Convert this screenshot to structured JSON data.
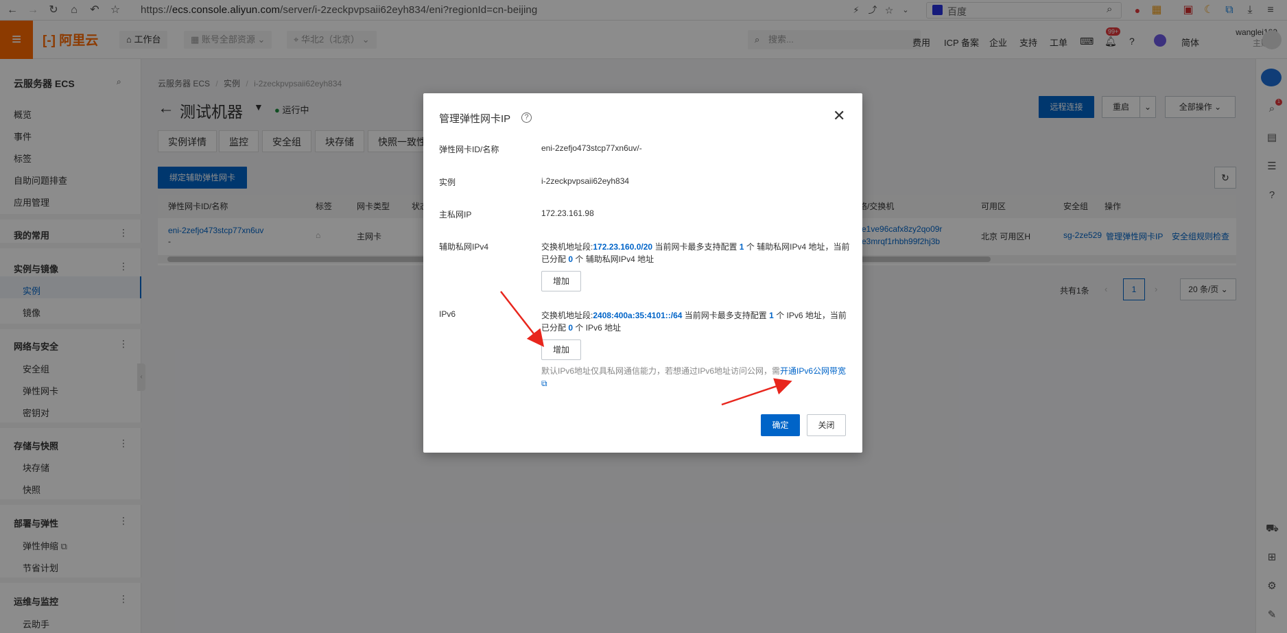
{
  "browser": {
    "url_prefix": "https://",
    "url_host": "ecs.console.aliyun.com",
    "url_path": "/server/i-2zeckpvpsaii62eyh834/eni?regionId=cn-beijing",
    "search_engine": "百度"
  },
  "topbar": {
    "logo": "阿里云",
    "workbench": "工作台",
    "resource": "账号全部资源",
    "region": "华北2（北京）",
    "search_placeholder": "搜索...",
    "links": [
      "费用",
      "ICP 备案",
      "企业",
      "支持",
      "工单"
    ],
    "badge": "99+",
    "lang": "简体",
    "username": "wanglei189",
    "account_type": "主账号"
  },
  "sidebar": {
    "title": "云服务器 ECS",
    "items": [
      "概览",
      "事件",
      "标签",
      "自助问题排查",
      "应用管理"
    ],
    "groups": [
      {
        "label": "我的常用",
        "items": []
      },
      {
        "label": "实例与镜像",
        "items": [
          "实例",
          "镜像"
        ]
      },
      {
        "label": "网络与安全",
        "items": [
          "安全组",
          "弹性网卡",
          "密钥对"
        ]
      },
      {
        "label": "存储与快照",
        "items": [
          "块存储",
          "快照"
        ]
      },
      {
        "label": "部署与弹性",
        "items": [
          "弹性伸缩",
          "节省计划"
        ]
      },
      {
        "label": "运维与监控",
        "items": [
          "云助手"
        ]
      }
    ]
  },
  "main": {
    "breadcrumb": [
      "云服务器 ECS",
      "实例",
      "i-2zeckpvpsaii62eyh834"
    ],
    "instance_name": "测试机器",
    "status": "运行中",
    "tabs": [
      "实例详情",
      "监控",
      "安全组",
      "块存储",
      "快照一致性"
    ],
    "bind_button": "绑定辅助弹性网卡",
    "actions": {
      "remote": "远程连接",
      "restart": "重启",
      "all": "全部操作"
    },
    "table": {
      "headers": [
        "弹性网卡ID/名称",
        "标签",
        "网卡类型",
        "状态",
        "网络/交换机",
        "可用区",
        "安全组",
        "操作"
      ],
      "row": {
        "eni_id": "eni-2zefjo473stcp77xn6uv",
        "eni_name": "-",
        "type": "主网卡",
        "vpc": "ze1ve96cafx8zy2qo09r",
        "vswitch": "ze3mrqf1rhbh99f2hj3b",
        "zone": "北京 可用区H",
        "sg": "sg-2ze529",
        "op1": "管理弹性网卡IP",
        "op2": "安全组规则检查"
      }
    },
    "pagination": {
      "total": "共有1条",
      "page": "1",
      "size": "20 条/页"
    }
  },
  "modal": {
    "title": "管理弹性网卡IP",
    "fields": {
      "eni_label": "弹性网卡ID/名称",
      "eni_value": "eni-2zefjo473stcp77xn6uv/-",
      "instance_label": "实例",
      "instance_value": "i-2zeckpvpsaii62eyh834",
      "primary_label": "主私网IP",
      "primary_value": "172.23.161.98",
      "ipv4_label": "辅助私网IPv4",
      "ipv4_seg_prefix": "交换机地址段:",
      "ipv4_seg": "172.23.160.0/20",
      "ipv4_max_prefix": "当前网卡最多支持配置",
      "ipv4_max": "1",
      "ipv4_max_suffix": "个 辅助私网IPv4 地址，当前已分配",
      "ipv4_used": "0",
      "ipv4_used_suffix": "个 辅助私网IPv4 地址",
      "ipv6_label": "IPv6",
      "ipv6_seg_prefix": "交换机地址段:",
      "ipv6_seg": "2408:400a:35:4101::/64",
      "ipv6_max_prefix": "当前网卡最多支持配置",
      "ipv6_max": "1",
      "ipv6_max_suffix": "个 IPv6 地址，当前已分配",
      "ipv6_used": "0",
      "ipv6_used_suffix": "个 IPv6 地址",
      "ipv6_note": "默认IPv6地址仅具私网通信能力，若想通过IPv6地址访问公网，需",
      "ipv6_note_link": "开通IPv6公网带宽"
    },
    "add_label": "增加",
    "ok": "确定",
    "close": "关闭"
  },
  "colors": {
    "accent": "#0064c8",
    "brand": "#ff6a00",
    "arrow": "#e8261d",
    "running": "#1e8e3e"
  }
}
